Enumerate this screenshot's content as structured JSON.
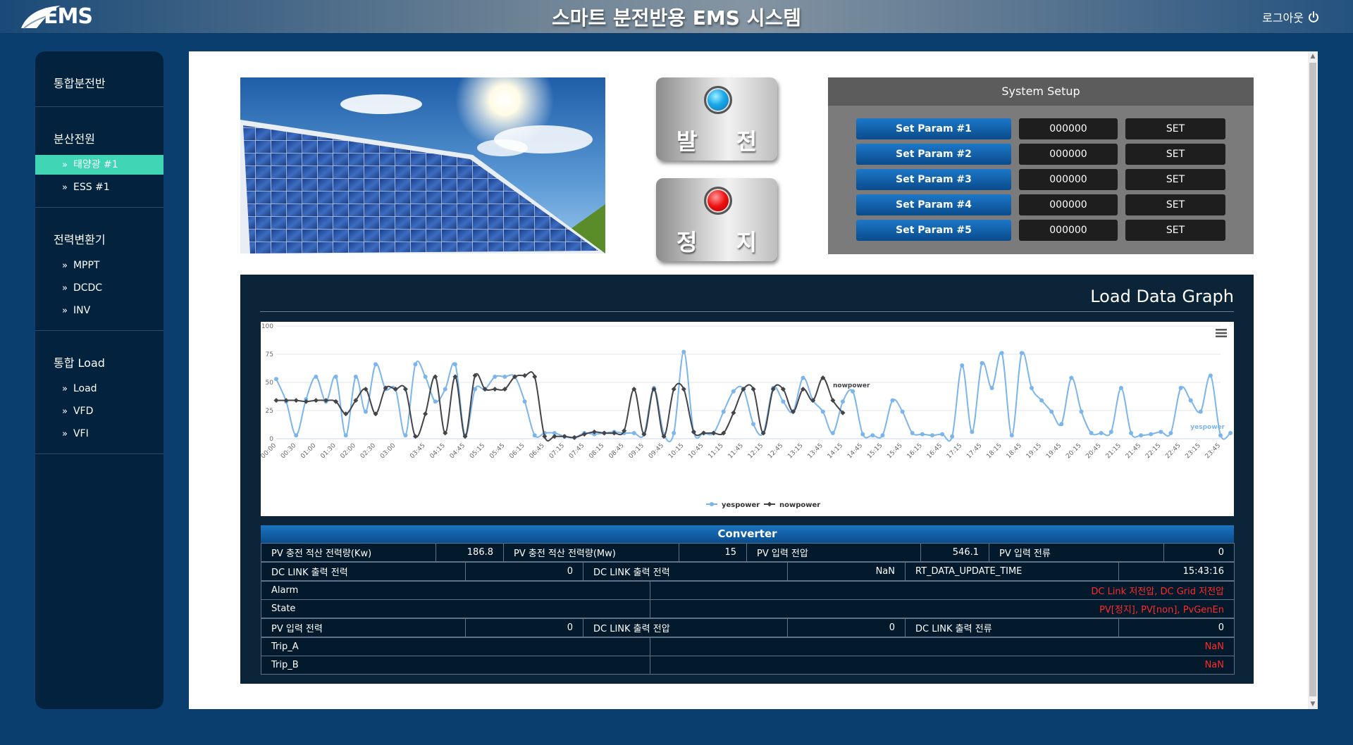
{
  "header": {
    "logo_text": "EMS",
    "title": "스마트 분전반용 EMS 시스템",
    "logout_label": "로그아웃",
    "logout_icon": "power-icon"
  },
  "sidebar": {
    "groups": [
      {
        "title": "통합분전반",
        "items": []
      },
      {
        "title": "분산전원",
        "items": [
          {
            "label": "태양광 #1",
            "active": true
          },
          {
            "label": "ESS #1"
          }
        ]
      },
      {
        "title": "전력변환기",
        "items": [
          {
            "label": "MPPT"
          },
          {
            "label": "DCDC"
          },
          {
            "label": "INV"
          }
        ]
      },
      {
        "title": "통합 Load",
        "items": [
          {
            "label": "Load"
          },
          {
            "label": "VFD"
          },
          {
            "label": "VFI"
          }
        ]
      }
    ],
    "active_color": "#3fd5b5"
  },
  "controls": {
    "generate_label": "발 전",
    "stop_label": "정 지",
    "generate_lamp_color": "#1aa9e8",
    "stop_lamp_color": "#ee1010"
  },
  "setup": {
    "title": "System Setup",
    "rows": [
      {
        "param": "Set Param #1",
        "value": "000000",
        "button": "SET"
      },
      {
        "param": "Set Param #2",
        "value": "000000",
        "button": "SET"
      },
      {
        "param": "Set Param #3",
        "value": "000000",
        "button": "SET"
      },
      {
        "param": "Set Param #4",
        "value": "000000",
        "button": "SET"
      },
      {
        "param": "Set Param #5",
        "value": "000000",
        "button": "SET"
      }
    ]
  },
  "graph": {
    "title": "Load Data Graph"
  },
  "chart_data": {
    "type": "line",
    "ylim": [
      0,
      100
    ],
    "yticks": [
      0,
      25,
      50,
      75,
      100
    ],
    "grid": true,
    "legend_position": "bottom-center",
    "x": [
      "00:00",
      "00:15",
      "00:30",
      "00:45",
      "01:00",
      "01:15",
      "01:30",
      "01:45",
      "02:00",
      "02:15",
      "02:30",
      "02:45",
      "03:00",
      "03:15",
      "03:30",
      "03:45",
      "04:00",
      "04:15",
      "04:30",
      "04:45",
      "05:00",
      "05:15",
      "05:30",
      "05:45",
      "06:00",
      "06:15",
      "06:30",
      "06:45",
      "07:00",
      "07:15",
      "07:30",
      "07:45",
      "08:00",
      "08:15",
      "08:30",
      "08:45",
      "09:00",
      "09:15",
      "09:30",
      "09:45",
      "10:00",
      "10:15",
      "10:30",
      "10:45",
      "11:00",
      "11:15",
      "11:30",
      "11:45",
      "12:00",
      "12:15",
      "12:30",
      "12:45",
      "13:00",
      "13:15",
      "13:30",
      "13:45",
      "14:00",
      "14:15",
      "14:30",
      "14:45",
      "15:00",
      "15:15",
      "15:30",
      "15:45",
      "16:00",
      "16:15",
      "16:30",
      "16:45",
      "17:00",
      "17:15",
      "17:30",
      "17:45",
      "18:00",
      "18:15",
      "18:30",
      "18:45",
      "19:00",
      "19:15",
      "19:30",
      "19:45",
      "20:00",
      "20:15",
      "20:30",
      "20:45",
      "21:00",
      "21:15",
      "21:30",
      "21:45",
      "22:00",
      "22:15",
      "22:30",
      "22:45",
      "23:00",
      "23:15",
      "23:30",
      "23:45"
    ],
    "xtick_labels": [
      "00:00",
      "00:30",
      "01:00",
      "01:30",
      "02:00",
      "02:30",
      "03:00",
      "03:45",
      "04:15",
      "04:45",
      "05:15",
      "05:45",
      "06:15",
      "06:45",
      "07:15",
      "07:45",
      "08:15",
      "08:45",
      "09:15",
      "09:45",
      "10:15",
      "10:45",
      "11:15",
      "11:45",
      "12:15",
      "12:45",
      "13:15",
      "13:45",
      "14:15",
      "14:45",
      "15:15",
      "15:45",
      "16:15",
      "16:45",
      "17:15",
      "17:45",
      "18:15",
      "18:45",
      "19:15",
      "19:45",
      "20:15",
      "20:45",
      "21:15",
      "21:45",
      "22:15",
      "22:45",
      "23:15",
      "23:45"
    ],
    "series": [
      {
        "name": "yespower",
        "color": "#7cb5ec",
        "marker": "circle",
        "end_label": "yespower",
        "values": [
          53,
          33,
          3,
          35,
          55,
          33,
          55,
          3,
          55,
          24,
          66,
          44,
          44,
          3,
          66,
          55,
          33,
          44,
          66,
          3,
          44,
          44,
          55,
          55,
          55,
          33,
          3,
          5,
          5,
          2,
          1,
          5,
          4,
          5,
          6,
          5,
          5,
          4,
          45,
          4,
          5,
          77,
          6,
          5,
          5,
          24,
          42,
          44,
          13,
          5,
          45,
          33,
          24,
          54,
          34,
          24,
          5,
          33,
          42,
          4,
          3,
          3,
          34,
          24,
          5,
          4,
          3,
          4,
          2,
          65,
          6,
          67,
          45,
          76,
          3,
          76,
          45,
          34,
          24,
          13,
          54,
          24,
          5,
          5,
          6,
          45,
          5,
          3,
          4,
          6,
          5,
          45,
          34,
          24,
          56,
          3,
          5
        ]
      },
      {
        "name": "nowpower",
        "color": "#434348",
        "marker": "diamond",
        "end_label": "nowpower",
        "values": [
          34,
          34,
          34,
          33,
          34,
          34,
          33,
          22,
          34,
          44,
          22,
          45,
          44,
          44,
          2,
          22,
          55,
          5,
          55,
          2,
          56,
          44,
          44,
          44,
          55,
          56,
          55,
          2,
          2,
          2,
          1,
          4,
          6,
          5,
          5,
          7,
          44,
          4,
          44,
          2,
          44,
          44,
          6,
          5,
          5,
          5,
          23,
          44,
          44,
          5,
          44,
          44,
          24,
          44,
          34,
          54,
          34,
          23
        ]
      }
    ]
  },
  "converter": {
    "title": "Converter",
    "row1": [
      {
        "label": "PV 충전 적산 전력량(Kw)",
        "value": "186.8"
      },
      {
        "label": "PV 충전 적산 전력량(Mw)",
        "value": "15"
      },
      {
        "label": "PV 입력 전압",
        "value": "546.1"
      },
      {
        "label": "PV 입력 전류",
        "value": "0"
      }
    ],
    "row2": [
      {
        "label": "DC LINK 출력 전력",
        "value": "0"
      },
      {
        "label": "DC LINK 출력 전력",
        "value": "NaN"
      },
      {
        "label": "RT_DATA_UPDATE_TIME",
        "value": "15:43:16"
      }
    ],
    "alarm": {
      "label": "Alarm",
      "value": "DC Link 저전압, DC Grid 저전압"
    },
    "state": {
      "label": "State",
      "value": "PV[정지], PV[non], PvGenEn"
    },
    "row5": [
      {
        "label": "PV 입력 전력",
        "value": "0"
      },
      {
        "label": "DC LINK 출력 전압",
        "value": "0"
      },
      {
        "label": "DC LINK 출력 전류",
        "value": "0"
      }
    ],
    "trip_a": {
      "label": "Trip_A",
      "value": "NaN"
    },
    "trip_b": {
      "label": "Trip_B",
      "value": "NaN"
    },
    "alert_color": "#ff2a2a"
  }
}
